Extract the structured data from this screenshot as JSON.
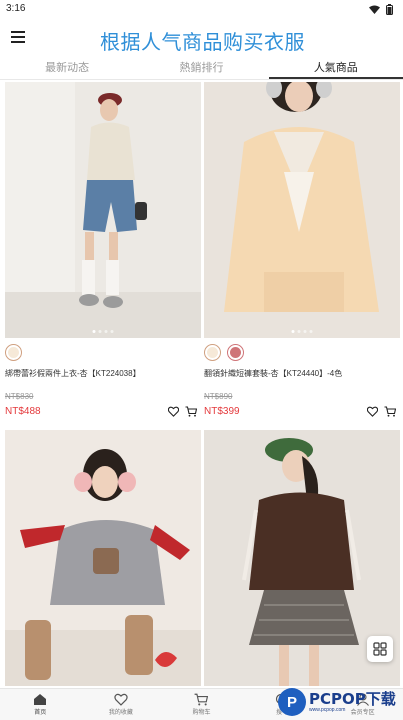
{
  "status_bar": {
    "time": "3:16"
  },
  "header": {
    "title": "根据人气商品购买衣服"
  },
  "tabs": [
    {
      "label": "最新动态",
      "active": false
    },
    {
      "label": "熱銷排行",
      "active": false
    },
    {
      "label": "人氣商品",
      "active": true
    }
  ],
  "products": [
    {
      "name": "綁帶蕾衫假兩件上衣-杏【KT224038】",
      "old_price": "NT$830",
      "price": "NT$488",
      "swatches": [
        "cream"
      ]
    },
    {
      "name": "翻領針織短褲套裝-杏【KT24440】-4色",
      "old_price": "NT$890",
      "price": "NT$399",
      "swatches": [
        "cream",
        "pink"
      ]
    },
    {
      "name": "",
      "old_price": "",
      "price": "",
      "swatches": []
    },
    {
      "name": "",
      "old_price": "",
      "price": "",
      "swatches": []
    }
  ],
  "bottom_nav": [
    {
      "label": "首页",
      "icon": "home-icon",
      "active": true
    },
    {
      "label": "我的收藏",
      "icon": "heart-icon",
      "active": false
    },
    {
      "label": "购物车",
      "icon": "cart-icon",
      "active": false
    },
    {
      "label": "搜寻",
      "icon": "search-icon",
      "active": false
    },
    {
      "label": "会员专区",
      "icon": "user-icon",
      "active": false
    }
  ],
  "watermark": {
    "brand": "PCPOP下载",
    "sub": "www.pcpop.com"
  },
  "colors": {
    "title_blue": "#2f8fd8",
    "price_red": "#e4393c"
  }
}
